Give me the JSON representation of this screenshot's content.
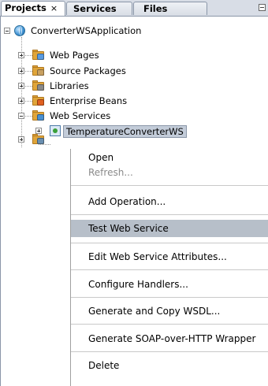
{
  "tabs": [
    {
      "label": "Projects",
      "close": "×"
    },
    {
      "label": "Services"
    },
    {
      "label": "Files"
    }
  ],
  "tree": {
    "project": "ConverterWSApplication",
    "nodes": [
      {
        "label": "Web Pages",
        "badge_color": "#5a9be0"
      },
      {
        "label": "Source Packages",
        "badge_color": "#c8a060"
      },
      {
        "label": "Libraries",
        "badge_color": "#8a8a8a"
      },
      {
        "label": "Enterprise Beans",
        "badge_color": "#e06020"
      },
      {
        "label": "Web Services",
        "badge_color": "#4a90d0"
      }
    ],
    "service": "TemperatureConverterWS"
  },
  "context_menu": {
    "items": [
      {
        "label": "Open",
        "state": "enabled"
      },
      {
        "label": "Refresh...",
        "state": "disabled"
      },
      {
        "label": "Add Operation...",
        "state": "enabled"
      },
      {
        "label": "Test Web Service",
        "state": "highlighted"
      },
      {
        "label": "Edit Web Service Attributes...",
        "state": "enabled"
      },
      {
        "label": "Configure Handlers...",
        "state": "enabled"
      },
      {
        "label": "Generate and Copy WSDL...",
        "state": "enabled"
      },
      {
        "label": "Generate SOAP-over-HTTP Wrapper",
        "state": "enabled"
      },
      {
        "label": "Delete",
        "state": "enabled"
      }
    ]
  },
  "colors": {
    "folder": "#e0a53a",
    "selection": "#c3ccd9",
    "menu_highlight": "#b7bfc9"
  }
}
